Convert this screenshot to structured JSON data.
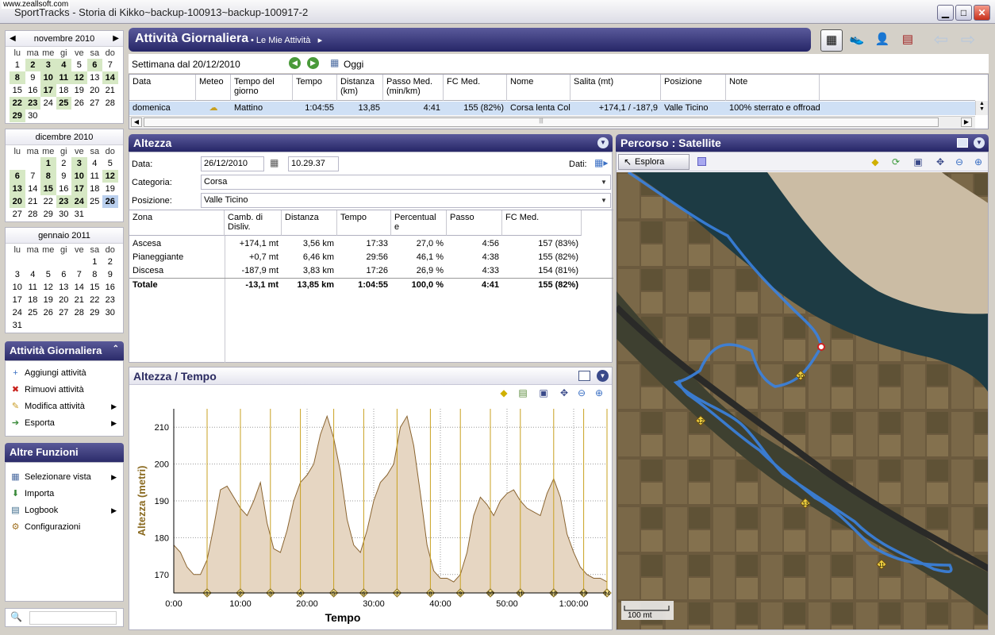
{
  "window": {
    "watermark": "www.zeallsoft.com",
    "title": "SportTracks - Storia di Kikko~backup-100913~backup-100917-2",
    "min": "▁",
    "max": "□",
    "close": "✕"
  },
  "calendars": [
    {
      "month": "novembre 2010",
      "prev": "◀",
      "next": "▶",
      "days": [
        "lu",
        "ma",
        "me",
        "gi",
        "ve",
        "sa",
        "do"
      ],
      "weeks": [
        [
          "1",
          "2",
          "3",
          "4",
          "5",
          "6",
          "7"
        ],
        [
          "8",
          "9",
          "10",
          "11",
          "12",
          "13",
          "14"
        ],
        [
          "15",
          "16",
          "17",
          "18",
          "19",
          "20",
          "21"
        ],
        [
          "22",
          "23",
          "24",
          "25",
          "26",
          "27",
          "28"
        ],
        [
          "29",
          "30",
          "",
          "",
          "",
          "",
          ""
        ]
      ],
      "highlighted": [
        "2",
        "3",
        "4",
        "6",
        "8",
        "10",
        "11",
        "12",
        "14",
        "17",
        "22",
        "23",
        "25",
        "29"
      ],
      "selected": []
    },
    {
      "month": "dicembre 2010",
      "prev": "",
      "next": "",
      "days": [
        "lu",
        "ma",
        "me",
        "gi",
        "ve",
        "sa",
        "do"
      ],
      "weeks": [
        [
          "",
          "",
          "1",
          "2",
          "3",
          "4",
          "5"
        ],
        [
          "6",
          "7",
          "8",
          "9",
          "10",
          "11",
          "12"
        ],
        [
          "13",
          "14",
          "15",
          "16",
          "17",
          "18",
          "19"
        ],
        [
          "20",
          "21",
          "22",
          "23",
          "24",
          "25",
          "26"
        ],
        [
          "27",
          "28",
          "29",
          "30",
          "31",
          "",
          ""
        ]
      ],
      "highlighted": [
        "1",
        "3",
        "6",
        "8",
        "10",
        "12",
        "13",
        "15",
        "17",
        "20",
        "23",
        "24"
      ],
      "selected": [
        "26"
      ]
    },
    {
      "month": "gennaio 2011",
      "prev": "",
      "next": "",
      "days": [
        "lu",
        "ma",
        "me",
        "gi",
        "ve",
        "sa",
        "do"
      ],
      "weeks": [
        [
          "",
          "",
          "",
          "",
          "",
          "1",
          "2"
        ],
        [
          "3",
          "4",
          "5",
          "6",
          "7",
          "8",
          "9"
        ],
        [
          "10",
          "11",
          "12",
          "13",
          "14",
          "15",
          "16"
        ],
        [
          "17",
          "18",
          "19",
          "20",
          "21",
          "22",
          "23"
        ],
        [
          "24",
          "25",
          "26",
          "27",
          "28",
          "29",
          "30"
        ],
        [
          "31",
          "",
          "",
          "",
          "",
          "",
          ""
        ]
      ],
      "highlighted": [],
      "selected": []
    }
  ],
  "daily_panel": {
    "title": "Attività Giornaliera",
    "items": [
      {
        "label": "Aggiungi attività",
        "icon": "add-activity-icon",
        "glyph": "+",
        "color": "#3a6fc4",
        "arrow": ""
      },
      {
        "label": "Rimuovi attività",
        "icon": "remove-activity-icon",
        "glyph": "✖",
        "color": "#c8201a",
        "arrow": ""
      },
      {
        "label": "Modifica attività",
        "icon": "edit-pencil-icon",
        "glyph": "✎",
        "color": "#c89a20",
        "arrow": "▶"
      },
      {
        "label": "Esporta",
        "icon": "export-icon",
        "glyph": "➔",
        "color": "#3a8a3a",
        "arrow": "▶"
      }
    ]
  },
  "other_panel": {
    "title": "Altre Funzioni",
    "items": [
      {
        "label": "Selezionare vista",
        "icon": "view-select-icon",
        "glyph": "▦",
        "color": "#4a6aa0",
        "arrow": "▶"
      },
      {
        "label": "Importa",
        "icon": "import-icon",
        "glyph": "⬇",
        "color": "#3a8a3a",
        "arrow": ""
      },
      {
        "label": "Logbook",
        "icon": "logbook-icon",
        "glyph": "▤",
        "color": "#3a6a8a",
        "arrow": "▶"
      },
      {
        "label": "Configurazioni",
        "icon": "settings-gear-icon",
        "glyph": "⚙",
        "color": "#a07020",
        "arrow": ""
      }
    ]
  },
  "search": {
    "icon": "🔍",
    "value": ""
  },
  "main": {
    "title": "Attività Giornaliera",
    "breadcrumb": "• Le Mie Attività",
    "breadcrumb_arrow": "▸"
  },
  "toolbar": {
    "calendar": "▦",
    "shoe": "👟",
    "athlete": "👤",
    "logbook": "▤",
    "back": "⇦",
    "forward": "⇨"
  },
  "week": {
    "label": "Settimana dal 20/12/2010",
    "prev": "◀",
    "next": "▶",
    "today_icon": "▦",
    "today": "Oggi"
  },
  "activity_table": {
    "columns": [
      "Data",
      "Meteo",
      "Tempo del giorno",
      "Tempo",
      "Distanza (km)",
      "Passo Med. (min/km)",
      "FC Med.",
      "Nome",
      "Salita (mt)",
      "Posizione",
      "Note"
    ],
    "rows": [
      [
        "domenica",
        "☁",
        "Mattino",
        "1:04:55",
        "13,85",
        "4:41",
        "155 (82%)",
        "Corsa  lenta  Colli...",
        "+174,1 / -187,9",
        "Valle Ticino",
        "100% sterrato e offroad"
      ]
    ],
    "scroll_left": "◀",
    "scroll_right": "▶",
    "scroll_mid": "|||"
  },
  "altitude_panel": {
    "title": "Altezza",
    "collapse": "▼",
    "date_label": "Data:",
    "date": "26/12/2010",
    "time": "10.29.37",
    "dati_label": "Dati:",
    "category_label": "Categoria:",
    "category": "Corsa",
    "position_label": "Posizione:",
    "position": "Valle Ticino",
    "zone_columns": [
      "Zona",
      "Camb. di Disliv.",
      "Distanza",
      "Tempo",
      "Percentual e",
      "Passo",
      "FC Med."
    ],
    "zones": [
      [
        "Ascesa",
        "+174,1 mt",
        "3,56 km",
        "17:33",
        "27,0 %",
        "4:56",
        "157 (83%)"
      ],
      [
        "Pianeggiante",
        "+0,7 mt",
        "6,46 km",
        "29:56",
        "46,1 %",
        "4:38",
        "155 (82%)"
      ],
      [
        "Discesa",
        "-187,9 mt",
        "3,83 km",
        "17:26",
        "26,9 %",
        "4:33",
        "154 (81%)"
      ]
    ],
    "total": [
      "Totale",
      "-13,1 mt",
      "13,85 km",
      "1:04:55",
      "100,0 %",
      "4:41",
      "155 (82%)"
    ]
  },
  "chart_panel": {
    "title": "Altezza / Tempo"
  },
  "chart_data": {
    "type": "area",
    "title": "",
    "xlabel": "Tempo",
    "ylabel": "Altezza (metri)",
    "ylim": [
      165,
      215
    ],
    "x_ticks": [
      "0:00",
      "10:00",
      "20:00",
      "30:00",
      "40:00",
      "50:00",
      "1:00:00"
    ],
    "y_ticks": [
      170,
      180,
      190,
      200,
      210
    ],
    "grid": "dotted",
    "fill": "#e6d6c2",
    "line": "#8a6430",
    "marker_color": "#c8a020",
    "lap_markers": [
      {
        "label": "1",
        "t": 5
      },
      {
        "label": "2",
        "t": 10
      },
      {
        "label": "3",
        "t": 14.5
      },
      {
        "label": "4",
        "t": 19
      },
      {
        "label": "5",
        "t": 24
      },
      {
        "label": "6",
        "t": 28.5
      },
      {
        "label": "7",
        "t": 33.5
      },
      {
        "label": "8",
        "t": 38.5
      },
      {
        "label": "9",
        "t": 43
      },
      {
        "label": "10",
        "t": 47.5
      },
      {
        "label": "11",
        "t": 52
      },
      {
        "label": "12",
        "t": 57
      },
      {
        "label": "13",
        "t": 61.5
      },
      {
        "label": "14",
        "t": 65
      }
    ],
    "series": [
      {
        "t": [
          0,
          1,
          2,
          3,
          4,
          5,
          6,
          7,
          8,
          9,
          10,
          11,
          12,
          13,
          14,
          15,
          16,
          17,
          18,
          19,
          20,
          21,
          22,
          23,
          24,
          25,
          26,
          27,
          28,
          29,
          30,
          31,
          32,
          33,
          34,
          35,
          36,
          37,
          38,
          39,
          40,
          41,
          42,
          43,
          44,
          45,
          46,
          47,
          48,
          49,
          50,
          51,
          52,
          53,
          54,
          55,
          56,
          57,
          58,
          59,
          60,
          61,
          62,
          63,
          64,
          65
        ],
        "y": [
          178,
          176,
          172,
          170,
          170,
          174,
          183,
          193,
          194,
          191,
          188,
          186,
          190,
          195,
          184,
          177,
          176,
          182,
          190,
          195,
          197,
          200,
          208,
          213,
          207,
          198,
          185,
          178,
          176,
          182,
          190,
          195,
          197,
          200,
          210,
          213,
          205,
          192,
          178,
          171,
          169,
          169,
          168,
          170,
          176,
          186,
          191,
          189,
          186,
          190,
          192,
          193,
          190,
          188,
          187,
          186,
          192,
          196,
          191,
          181,
          176,
          172,
          170,
          169,
          169,
          168
        ]
      }
    ]
  },
  "map_panel": {
    "title": "Percorso  : Satellite",
    "explore": "Esplora",
    "scale": "100 mt",
    "waypoints": [
      {
        "label": "10"
      },
      {
        "label": "12"
      },
      {
        "label": "13"
      },
      {
        "label": "11"
      }
    ]
  }
}
